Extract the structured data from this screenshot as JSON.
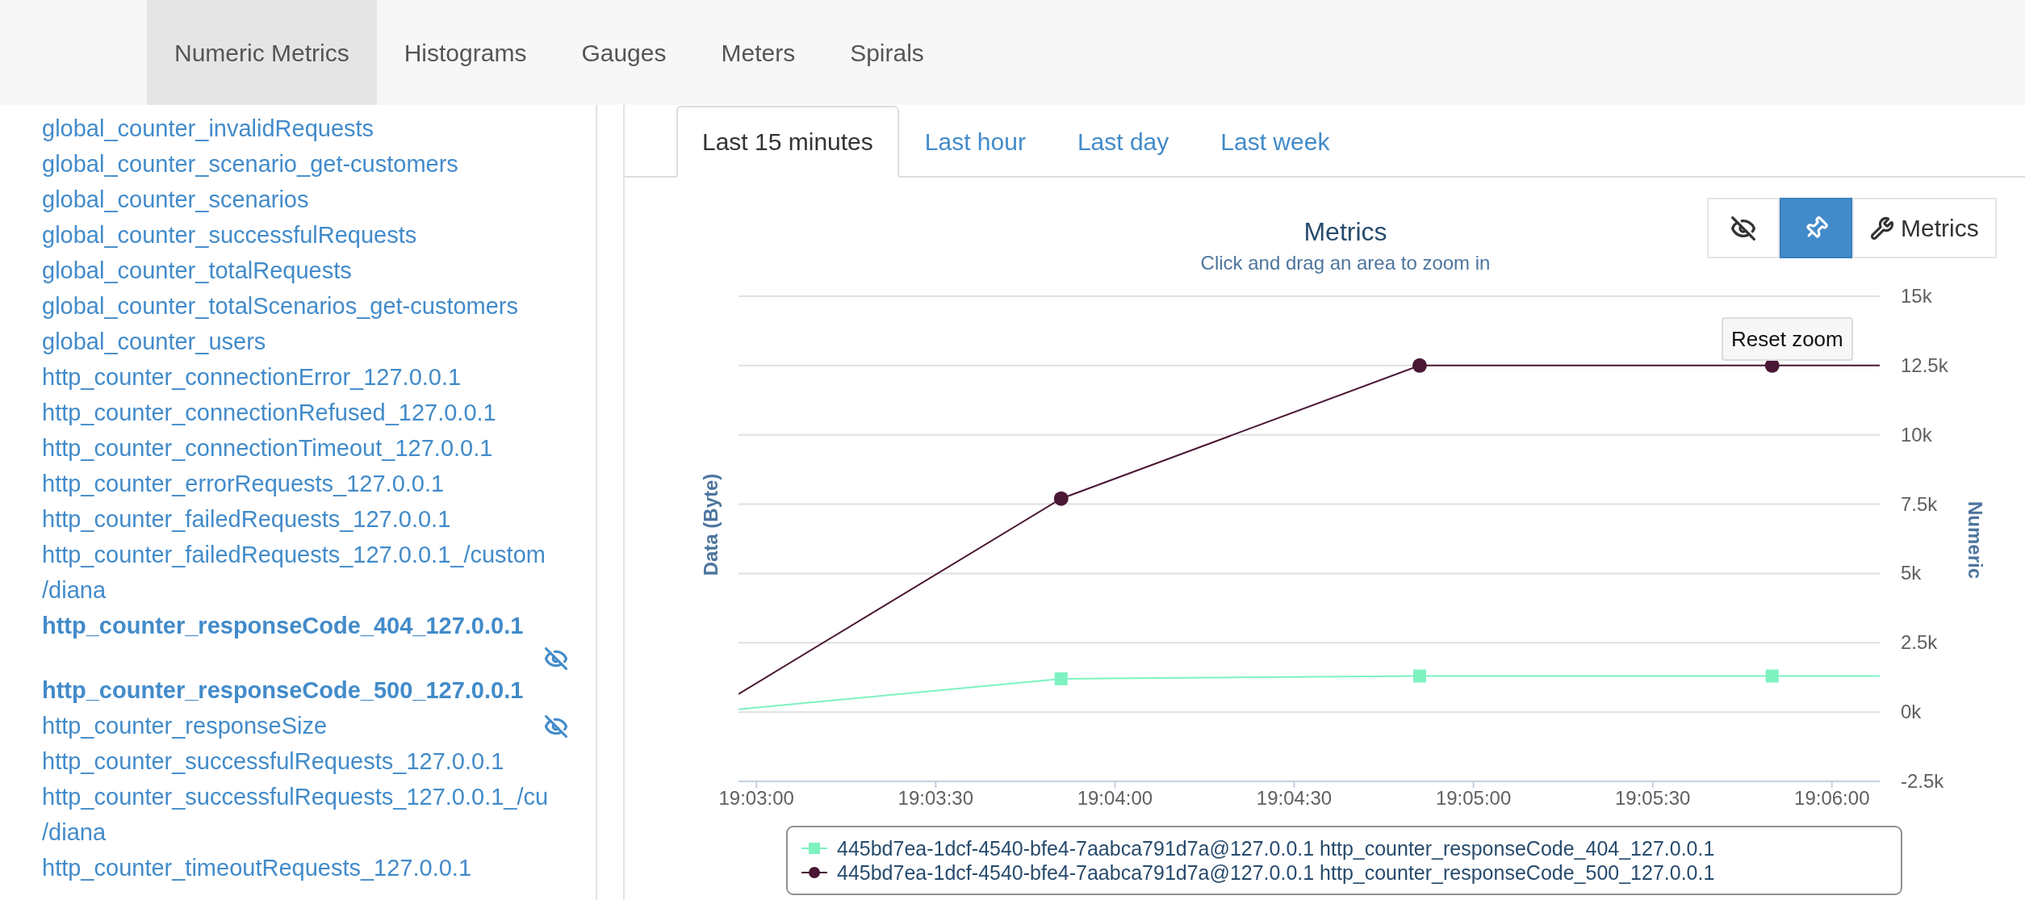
{
  "nav_tabs": [
    {
      "label": "Numeric Metrics",
      "selected": true
    },
    {
      "label": "Histograms",
      "selected": false
    },
    {
      "label": "Gauges",
      "selected": false
    },
    {
      "label": "Meters",
      "selected": false
    },
    {
      "label": "Spirals",
      "selected": false
    }
  ],
  "sidebar": {
    "items": [
      {
        "label": "global_counter_invalidRequests",
        "selected": false
      },
      {
        "label": "global_counter_scenario_get-customers",
        "selected": false
      },
      {
        "label": "global_counter_scenarios",
        "selected": false
      },
      {
        "label": "global_counter_successfulRequests",
        "selected": false
      },
      {
        "label": "global_counter_totalRequests",
        "selected": false
      },
      {
        "label": "global_counter_totalScenarios_get-customers",
        "selected": false
      },
      {
        "label": "global_counter_users",
        "selected": false
      },
      {
        "label": "http_counter_connectionError_127.0.0.1",
        "selected": false
      },
      {
        "label": "http_counter_connectionRefused_127.0.0.1",
        "selected": false
      },
      {
        "label": "http_counter_connectionTimeout_127.0.0.1",
        "selected": false
      },
      {
        "label": "http_counter_errorRequests_127.0.0.1",
        "selected": false
      },
      {
        "label": "http_counter_failedRequests_127.0.0.1",
        "selected": false
      },
      {
        "label": "http_counter_failedRequests_127.0.0.1_/custom",
        "continuation": "/diana",
        "selected": false
      },
      {
        "label": "http_counter_responseCode_404_127.0.0.1",
        "selected": true,
        "eye_toggle": true
      },
      {
        "label": "http_counter_responseCode_500_127.0.0.1",
        "selected": true
      },
      {
        "label": "http_counter_responseSize",
        "selected": false,
        "eye_toggle": true
      },
      {
        "label": "http_counter_successfulRequests_127.0.0.1",
        "selected": false
      },
      {
        "label": "http_counter_successfulRequests_127.0.0.1_/cu",
        "continuation": "/diana",
        "selected": false
      },
      {
        "label": "http_counter_timeoutRequests_127.0.0.1",
        "selected": false
      }
    ]
  },
  "time_tabs": [
    {
      "label": "Last 15 minutes",
      "selected": true
    },
    {
      "label": "Last hour",
      "selected": false
    },
    {
      "label": "Last day",
      "selected": false
    },
    {
      "label": "Last week",
      "selected": false
    }
  ],
  "chart_toolbar": [
    {
      "kind": "eye",
      "selected": false
    },
    {
      "kind": "pin",
      "selected": true
    },
    {
      "kind": "wrench",
      "label": "Metrics",
      "selected": false
    }
  ],
  "reset_zoom": "Reset zoom",
  "chart": {
    "left_axis_label": "Data (Byte)",
    "chart_data": {
      "type": "line",
      "title": "Metrics",
      "subtitle": "Click and drag an area to zoom in",
      "ylabel": "Numeric",
      "x": [
        68577,
        68631,
        68691,
        68750,
        68768
      ],
      "xlim": [
        68577,
        68768
      ],
      "ylim": [
        -2500,
        15000
      ],
      "grid": true,
      "legend": "bottom",
      "xticks": [
        {
          "value": 68580,
          "label": "19:03:00"
        },
        {
          "value": 68610,
          "label": "19:03:30"
        },
        {
          "value": 68640,
          "label": "19:04:00"
        },
        {
          "value": 68670,
          "label": "19:04:30"
        },
        {
          "value": 68700,
          "label": "19:05:00"
        },
        {
          "value": 68730,
          "label": "19:05:30"
        },
        {
          "value": 68760,
          "label": "19:06:00"
        }
      ],
      "yticks": [
        {
          "value": -2500,
          "label": "-2.5k"
        },
        {
          "value": 0,
          "label": "0k"
        },
        {
          "value": 2500,
          "label": "2.5k"
        },
        {
          "value": 5000,
          "label": "5k"
        },
        {
          "value": 7500,
          "label": "7.5k"
        },
        {
          "value": 10000,
          "label": "10k"
        },
        {
          "value": 12500,
          "label": "12.5k"
        },
        {
          "value": 15000,
          "label": "15k"
        }
      ],
      "series": [
        {
          "name": "445bd7ea-1dcf-4540-bfe4-7aabca791d7a@127.0.0.1 http_counter_responseCode_404_127.0.0.1",
          "color": "#7df2c0",
          "marker": "square",
          "values": [
            100,
            1200,
            1300,
            1300,
            1300
          ]
        },
        {
          "name": "445bd7ea-1dcf-4540-bfe4-7aabca791d7a@127.0.0.1 http_counter_responseCode_500_127.0.0.1",
          "color": "#4a1734",
          "marker": "circle",
          "values": [
            650,
            7700,
            12500,
            12500,
            12500
          ]
        }
      ]
    }
  }
}
